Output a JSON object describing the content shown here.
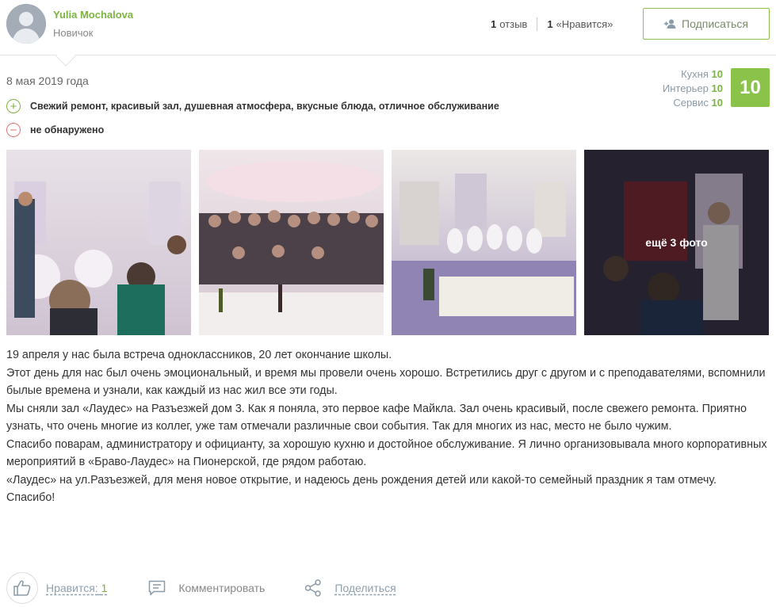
{
  "author": {
    "name": "Yulia Mochalova",
    "rank": "Новичок"
  },
  "stats": {
    "reviews_count": "1",
    "reviews_label": "отзыв",
    "likes_count": "1",
    "likes_label": "«Нравится»"
  },
  "subscribe_label": "Подписаться",
  "review": {
    "date": "8 мая 2019 года",
    "ratings": [
      {
        "label": "Кухня",
        "value": "10"
      },
      {
        "label": "Интерьер",
        "value": "10"
      },
      {
        "label": "Сервис",
        "value": "10"
      }
    ],
    "score": "10",
    "pros": "Свежий ремонт, красивый зал, душевная атмосфера, вкусные блюда, отличное обслуживание",
    "cons": "не обнаружено",
    "more_photos": "ещё 3 фото",
    "paragraphs": [
      "19 апреля у нас была встреча одноклассников, 20 лет окончание школы.",
      "Этот день для нас был очень эмоциональный, и время мы провели очень хорошо. Встретились друг с другом и с преподавателями, вспомнили былые времена и узнали, как каждый из нас жил все эти годы.",
      "Мы сняли зал «Лаудес» на Разъезжей дом 3. Как я поняла, это первое кафе Майкла. Зал очень красивый, после свежего ремонта. Приятно узнать, что очень многие из коллег, уже там отмечали различные свои события. Так для многих из нас, место не было чужим.",
      "Спасибо поварам, администратору и официанту, за хорошую кухню и достойное обслуживание. Я лично организовывала много корпоративных мероприятий в «Браво-Лаудес» на Пионерской, где рядом работаю.",
      "«Лаудес» на ул.Разъезжей, для меня новое открытие, и надеюсь день рождения детей или какой-то семейный праздник я там отмечу.",
      "Спасибо!"
    ]
  },
  "actions": {
    "like_label": "Нравится:",
    "like_count": "1",
    "comment_label": "Комментировать",
    "share_label": "Поделиться"
  },
  "colors": {
    "accent": "#8bc34a",
    "name": "#7cb342",
    "minus": "#e57373"
  }
}
